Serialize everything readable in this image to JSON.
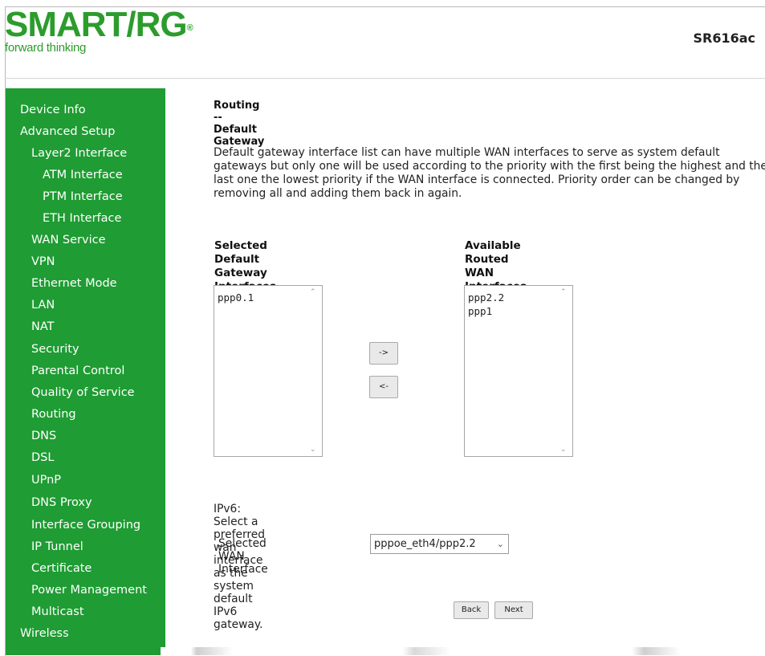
{
  "header": {
    "brand": "SMART/RG",
    "brand_mark": "®",
    "tagline": "forward thinking",
    "model": "SR616ac"
  },
  "sidebar": {
    "items": [
      {
        "label": "Device Info"
      },
      {
        "label": "Advanced Setup"
      },
      {
        "label": "Layer2 Interface"
      },
      {
        "label": "ATM Interface"
      },
      {
        "label": "PTM Interface"
      },
      {
        "label": "ETH Interface"
      },
      {
        "label": "WAN Service"
      },
      {
        "label": "VPN"
      },
      {
        "label": "Ethernet Mode"
      },
      {
        "label": "LAN"
      },
      {
        "label": "NAT"
      },
      {
        "label": "Security"
      },
      {
        "label": "Parental Control"
      },
      {
        "label": "Quality of Service"
      },
      {
        "label": "Routing"
      },
      {
        "label": "DNS"
      },
      {
        "label": "DSL"
      },
      {
        "label": "UPnP"
      },
      {
        "label": "DNS Proxy"
      },
      {
        "label": "Interface Grouping"
      },
      {
        "label": "IP Tunnel"
      },
      {
        "label": "Certificate"
      },
      {
        "label": "Power Management"
      },
      {
        "label": "Multicast"
      },
      {
        "label": "Wireless"
      }
    ]
  },
  "main": {
    "title": "Routing -- Default Gateway",
    "description": "Default gateway interface list can have multiple WAN interfaces to serve as system default gateways but only one will be used according to the priority with the first being the highest and the last one the lowest priority if the WAN interface is connected. Priority order can be changed by removing all and adding them back in again.",
    "selected_heading_1": "Selected Default",
    "selected_heading_2": "Gateway Interfaces",
    "available_heading_1": "Available Routed WAN",
    "available_heading_2": "Interfaces",
    "selected_list": [
      "ppp0.1"
    ],
    "available_list": [
      "ppp2.2",
      "ppp1"
    ],
    "move_right_label": "->",
    "move_left_label": "<-",
    "ipv6_text": "IPv6: Select a preferred wan interface as the system default IPv6 gateway.",
    "wan_select_label": "Selected WAN Interface",
    "wan_select_value": "pppoe_eth4/ppp2.2",
    "back_label": "Back",
    "next_label": "Next"
  },
  "colors": {
    "brand_green": "#2c9c2c",
    "sidebar_green": "#1f9c33"
  }
}
